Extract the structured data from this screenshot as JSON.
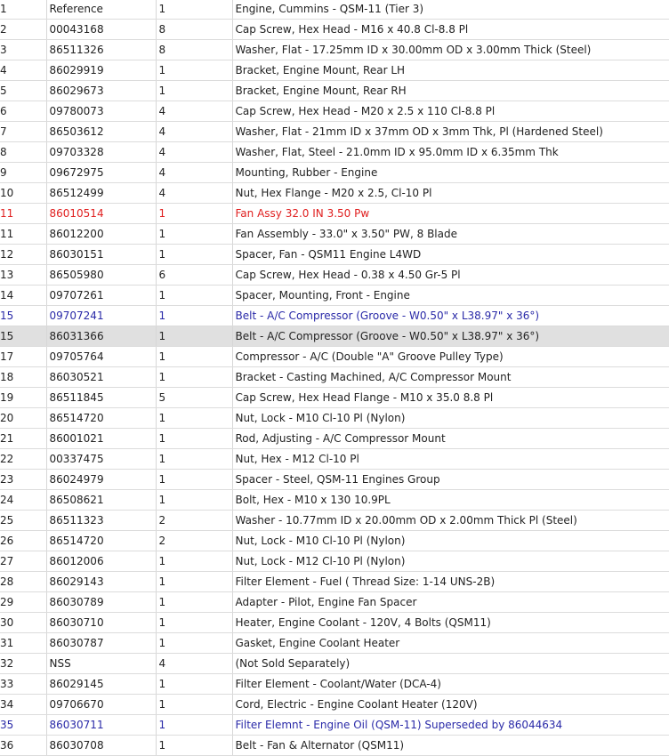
{
  "parts_table": {
    "rows": [
      {
        "ref": "1",
        "part": "Reference",
        "qty": "1",
        "desc": "Engine, Cummins - QSM-11 (Tier 3)",
        "style": ""
      },
      {
        "ref": "2",
        "part": "00043168",
        "qty": "8",
        "desc": "Cap Screw, Hex Head - M16 x 40.8 Cl-8.8 Pl",
        "style": ""
      },
      {
        "ref": "3",
        "part": "86511326",
        "qty": "8",
        "desc": "Washer, Flat - 17.25mm ID x 30.00mm OD x 3.00mm Thick (Steel)",
        "style": ""
      },
      {
        "ref": "4",
        "part": "86029919",
        "qty": "1",
        "desc": "Bracket, Engine Mount, Rear LH",
        "style": ""
      },
      {
        "ref": "5",
        "part": "86029673",
        "qty": "1",
        "desc": "Bracket, Engine Mount, Rear RH",
        "style": ""
      },
      {
        "ref": "6",
        "part": "09780073",
        "qty": "4",
        "desc": "Cap Screw, Hex Head - M20 x 2.5 x 110 Cl-8.8 Pl",
        "style": ""
      },
      {
        "ref": "7",
        "part": "86503612",
        "qty": "4",
        "desc": "Washer, Flat - 21mm ID x 37mm OD x 3mm Thk, Pl (Hardened Steel)",
        "style": ""
      },
      {
        "ref": "8",
        "part": "09703328",
        "qty": "4",
        "desc": "Washer, Flat, Steel - 21.0mm ID x 95.0mm ID x 6.35mm Thk",
        "style": ""
      },
      {
        "ref": "9",
        "part": "09672975",
        "qty": "4",
        "desc": "Mounting, Rubber - Engine",
        "style": ""
      },
      {
        "ref": "10",
        "part": "86512499",
        "qty": "4",
        "desc": "Nut, Hex Flange - M20 x 2.5, Cl-10 Pl",
        "style": ""
      },
      {
        "ref": "11",
        "part": "86010514",
        "qty": "1",
        "desc": "Fan Assy 32.0 IN 3.50 Pw",
        "style": "red"
      },
      {
        "ref": "11",
        "part": "86012200",
        "qty": "1",
        "desc": "Fan Assembly - 33.0\" x 3.50\" PW, 8 Blade",
        "style": ""
      },
      {
        "ref": "12",
        "part": "86030151",
        "qty": "1",
        "desc": "Spacer, Fan - QSM11 Engine L4WD",
        "style": ""
      },
      {
        "ref": "13",
        "part": "86505980",
        "qty": "6",
        "desc": "Cap Screw, Hex Head - 0.38 x 4.50 Gr-5 Pl",
        "style": ""
      },
      {
        "ref": "14",
        "part": "09707261",
        "qty": "1",
        "desc": "Spacer, Mounting, Front - Engine",
        "style": ""
      },
      {
        "ref": "15",
        "part": "09707241",
        "qty": "1",
        "desc": "Belt - A/C Compressor (Groove - W0.50\" x L38.97\" x 36°)",
        "style": "blue"
      },
      {
        "ref": "15",
        "part": "86031366",
        "qty": "1",
        "desc": "Belt - A/C Compressor (Groove - W0.50\" x L38.97\" x 36°)",
        "style": "hl"
      },
      {
        "ref": "17",
        "part": "09705764",
        "qty": "1",
        "desc": "Compressor - A/C (Double \"A\" Groove Pulley Type)",
        "style": ""
      },
      {
        "ref": "18",
        "part": "86030521",
        "qty": "1",
        "desc": "Bracket - Casting Machined, A/C Compressor Mount",
        "style": ""
      },
      {
        "ref": "19",
        "part": "86511845",
        "qty": "5",
        "desc": "Cap Screw, Hex Head Flange - M10 x 35.0 8.8 Pl",
        "style": ""
      },
      {
        "ref": "20",
        "part": "86514720",
        "qty": "1",
        "desc": "Nut, Lock - M10 Cl-10 Pl (Nylon)",
        "style": ""
      },
      {
        "ref": "21",
        "part": "86001021",
        "qty": "1",
        "desc": "Rod, Adjusting - A/C Compressor Mount",
        "style": ""
      },
      {
        "ref": "22",
        "part": "00337475",
        "qty": "1",
        "desc": "Nut, Hex - M12 Cl-10 Pl",
        "style": ""
      },
      {
        "ref": "23",
        "part": "86024979",
        "qty": "1",
        "desc": "Spacer - Steel, QSM-11 Engines Group",
        "style": ""
      },
      {
        "ref": "24",
        "part": "86508621",
        "qty": "1",
        "desc": "Bolt, Hex - M10 x 130 10.9PL",
        "style": ""
      },
      {
        "ref": "25",
        "part": "86511323",
        "qty": "2",
        "desc": "Washer - 10.77mm ID x 20.00mm OD x 2.00mm Thick Pl (Steel)",
        "style": ""
      },
      {
        "ref": "26",
        "part": "86514720",
        "qty": "2",
        "desc": "Nut, Lock - M10 Cl-10 Pl (Nylon)",
        "style": ""
      },
      {
        "ref": "27",
        "part": "86012006",
        "qty": "1",
        "desc": "Nut, Lock - M12 Cl-10 Pl (Nylon)",
        "style": ""
      },
      {
        "ref": "28",
        "part": "86029143",
        "qty": "1",
        "desc": "Filter Element - Fuel ( Thread Size: 1-14 UNS-2B)",
        "style": ""
      },
      {
        "ref": "29",
        "part": "86030789",
        "qty": "1",
        "desc": "Adapter - Pilot, Engine Fan Spacer",
        "style": ""
      },
      {
        "ref": "30",
        "part": "86030710",
        "qty": "1",
        "desc": "Heater, Engine Coolant - 120V, 4 Bolts (QSM11)",
        "style": ""
      },
      {
        "ref": "31",
        "part": "86030787",
        "qty": "1",
        "desc": "Gasket, Engine Coolant Heater",
        "style": ""
      },
      {
        "ref": "32",
        "part": "NSS",
        "qty": "4",
        "desc": "(Not Sold Separately)",
        "style": ""
      },
      {
        "ref": "33",
        "part": "86029145",
        "qty": "1",
        "desc": "Filter Element - Coolant/Water (DCA-4)",
        "style": ""
      },
      {
        "ref": "34",
        "part": "09706670",
        "qty": "1",
        "desc": "Cord, Electric - Engine Coolant Heater (120V)",
        "style": ""
      },
      {
        "ref": "35",
        "part": "86030711",
        "qty": "1",
        "desc": "Filter Elemnt - Engine Oil (QSM-11) Superseded by 86044634",
        "style": "blue"
      },
      {
        "ref": "36",
        "part": "86030708",
        "qty": "1",
        "desc": "Belt - Fan & Alternator (QSM11)",
        "style": ""
      }
    ]
  }
}
